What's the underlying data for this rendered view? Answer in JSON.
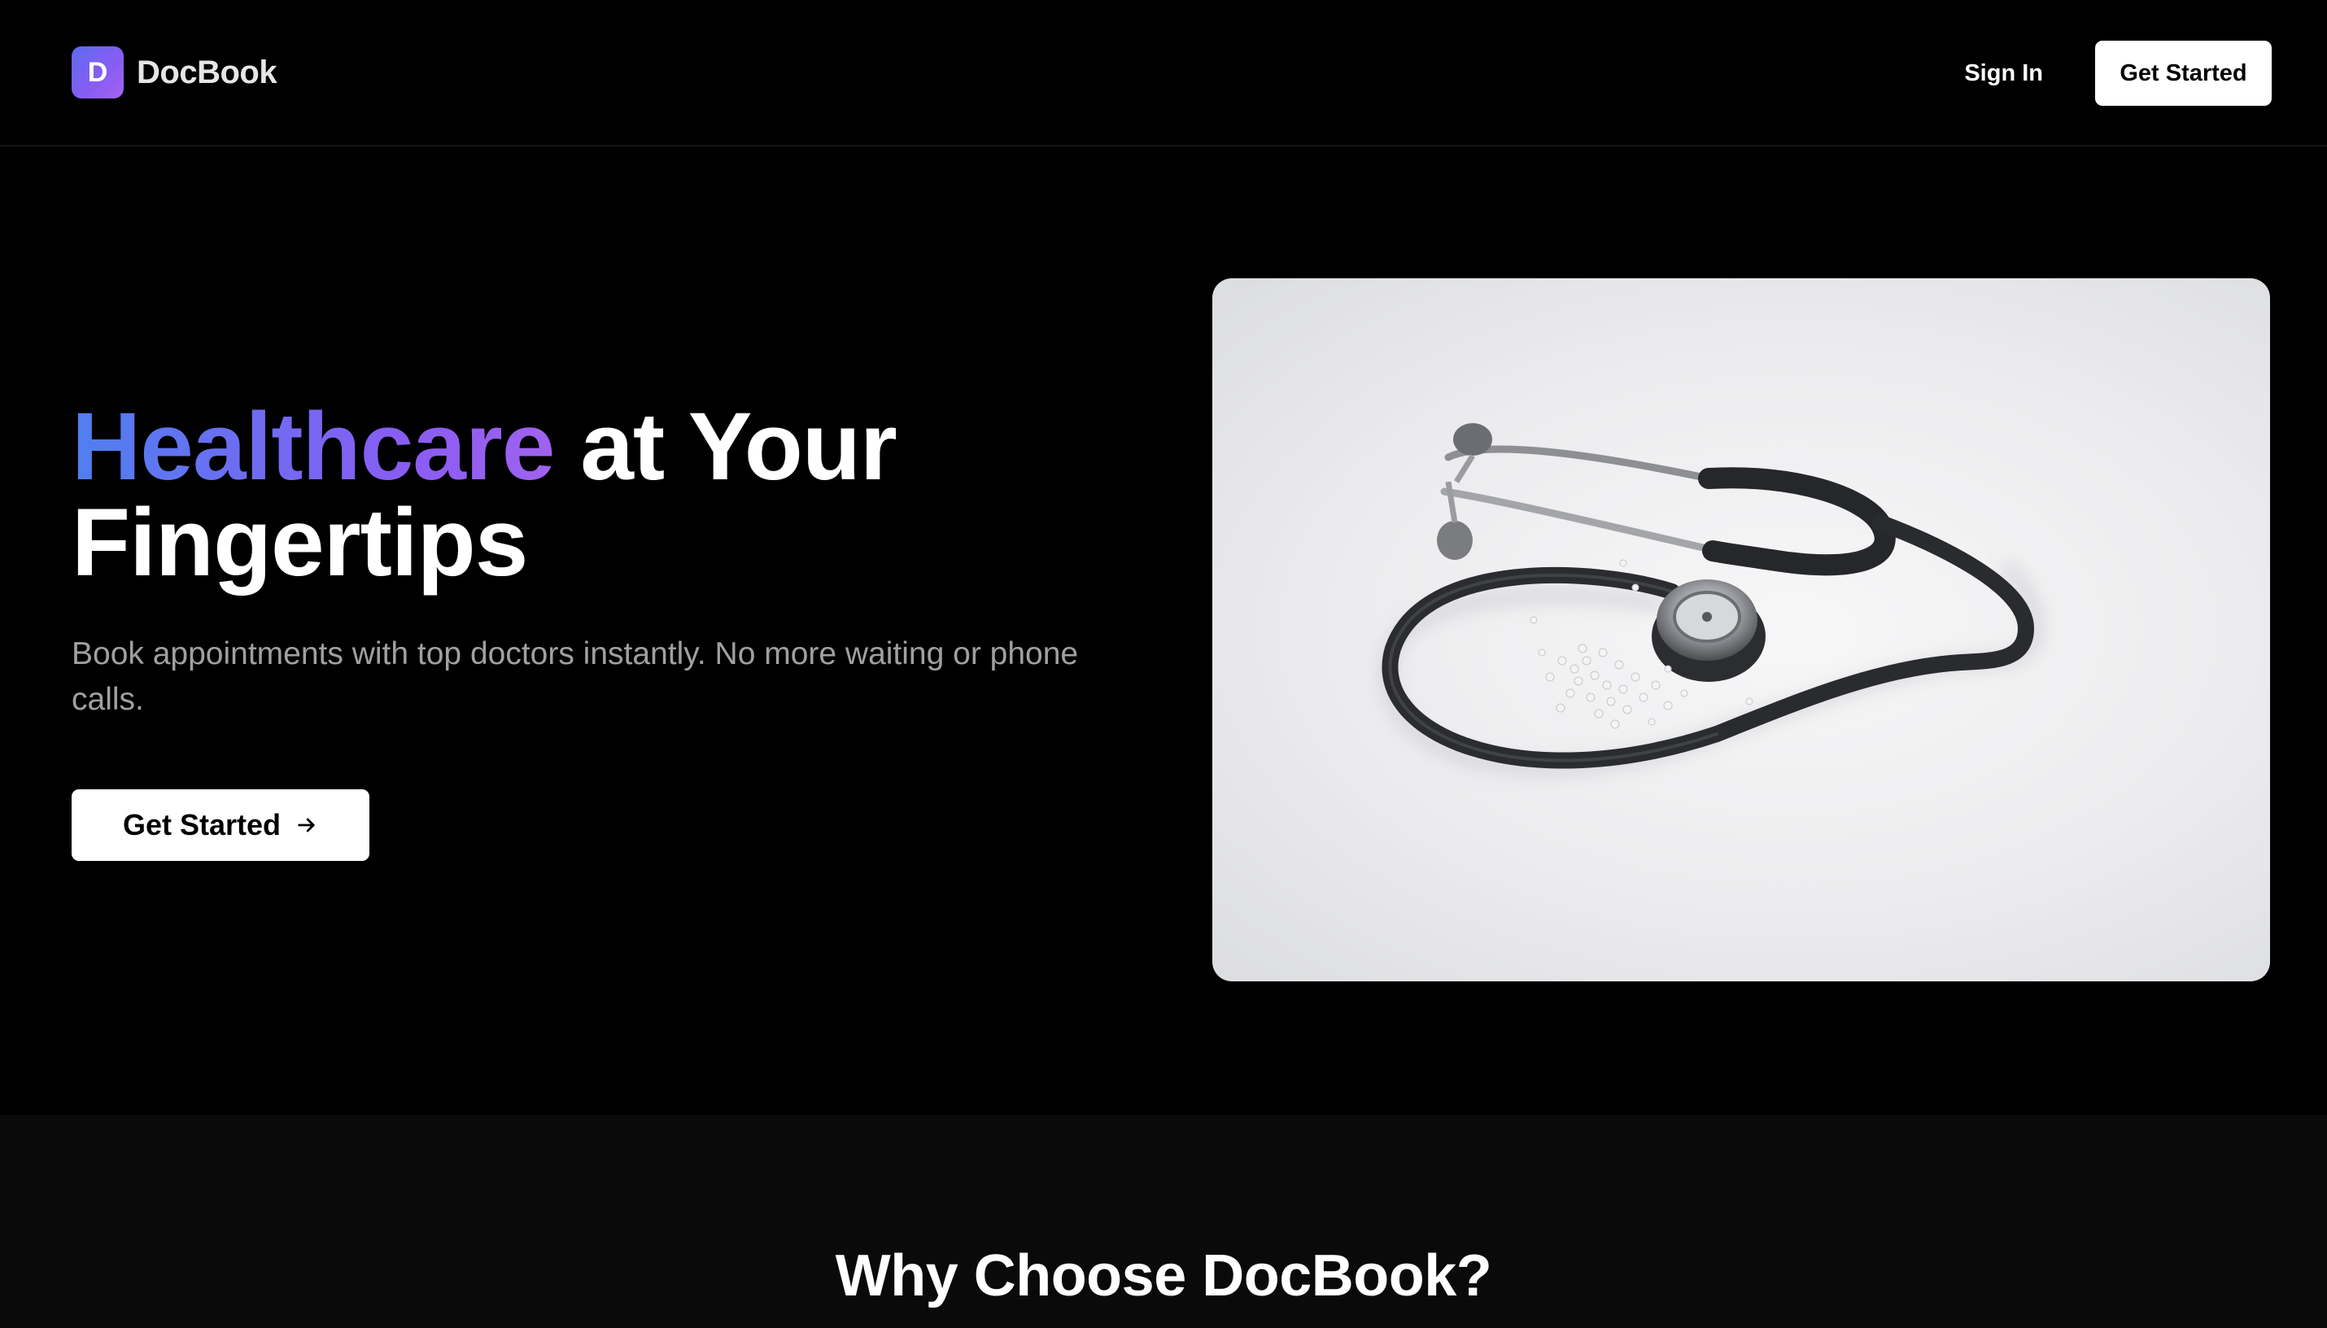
{
  "brand": {
    "logo_letter": "D",
    "name": "DocBook",
    "logo_gradient": [
      "#5b6cf0",
      "#a364f0"
    ]
  },
  "nav": {
    "signin_label": "Sign In",
    "cta_label": "Get Started"
  },
  "hero": {
    "title_accent": "Healthcare",
    "title_rest": " at Your Fingertips",
    "subtitle": "Book appointments with top doctors instantly. No more waiting or phone calls.",
    "cta_label": "Get Started",
    "cta_icon": "arrow-right-icon",
    "image_subject": "stethoscope-photo",
    "accent_gradient": [
      "#4f7ff0",
      "#a063ef"
    ]
  },
  "features": {
    "title": "Why Choose DocBook?"
  },
  "colors": {
    "background": "#000000",
    "section_alt": "#0a0a0a",
    "subtitle_text": "#a0a0a0",
    "button_bg": "#ffffff"
  }
}
